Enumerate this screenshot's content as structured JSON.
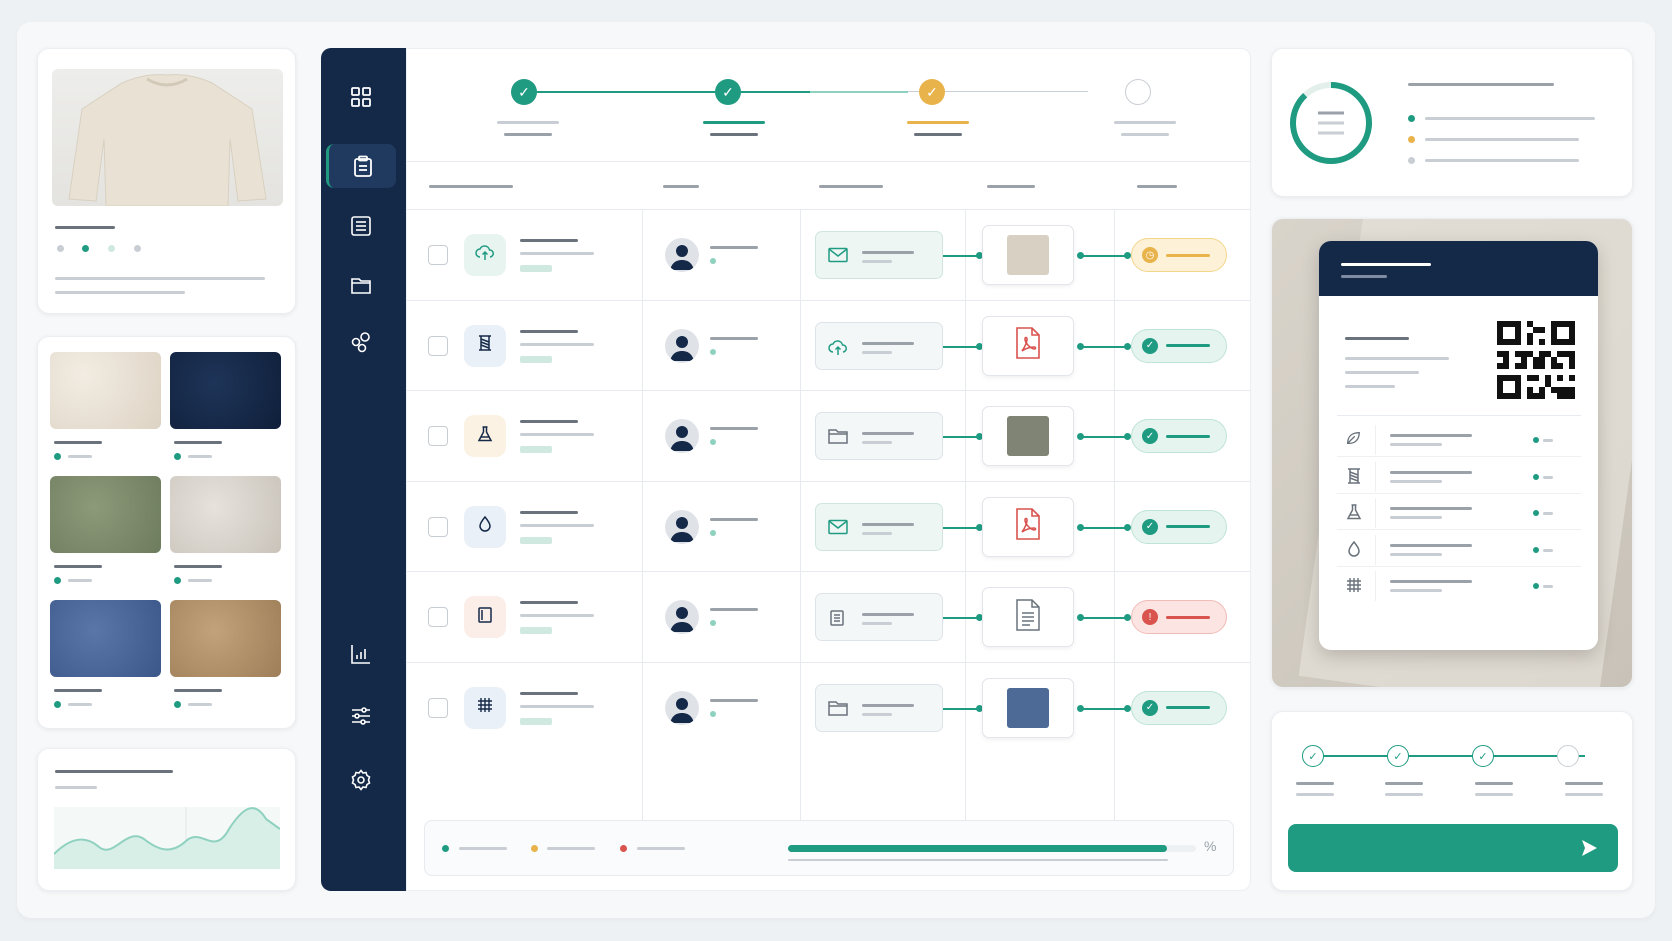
{
  "footer": {
    "percent_symbol": "%",
    "progress": 0.93
  },
  "colors": {
    "teal": "#1f9b82",
    "navy": "#142847",
    "amber": "#e8b34a",
    "red": "#d9534f"
  },
  "sidebar": {
    "items": [
      {
        "icon": "grid-icon",
        "active": false
      },
      {
        "icon": "clipboard-icon",
        "active": true
      },
      {
        "icon": "list-icon",
        "active": false
      },
      {
        "icon": "folder-icon",
        "active": false
      },
      {
        "icon": "network-icon",
        "active": false
      },
      {
        "icon": "chart-icon",
        "active": false
      },
      {
        "icon": "sliders-icon",
        "active": false
      },
      {
        "icon": "gear-icon",
        "active": false
      }
    ]
  },
  "stepper": {
    "steps": [
      {
        "state": "complete",
        "color": "#1f9b82"
      },
      {
        "state": "complete",
        "color": "#1f9b82"
      },
      {
        "state": "current",
        "color": "#e8b34a"
      },
      {
        "state": "pending",
        "color": "#c9ced4"
      }
    ]
  },
  "rows": [
    {
      "icon": "cloud-upload-icon",
      "doc_icon": "mail-icon",
      "attachment": "fabric-swatch",
      "status": "pending"
    },
    {
      "icon": "spool-icon",
      "doc_icon": "cloud-upload-icon",
      "attachment": "pdf-file-icon",
      "status": "approved"
    },
    {
      "icon": "flask-icon",
      "doc_icon": "folder-icon",
      "attachment": "fabric-swatch",
      "status": "approved"
    },
    {
      "icon": "water-drop-icon",
      "doc_icon": "mail-icon",
      "attachment": "pdf-file-icon",
      "status": "approved"
    },
    {
      "icon": "tag-icon",
      "doc_icon": "document-icon",
      "attachment": "text-file-icon",
      "status": "rejected"
    },
    {
      "icon": "weave-icon",
      "doc_icon": "folder-icon",
      "attachment": "fabric-swatch",
      "status": "approved"
    }
  ],
  "passport": {
    "rows": [
      "leaf-icon",
      "spool-icon",
      "flask-icon",
      "water-drop-icon",
      "weave-icon"
    ]
  },
  "bottom_stepper": {
    "steps": [
      "complete",
      "complete",
      "complete",
      "pending"
    ]
  },
  "submit": {
    "icon": "send-arrow-icon"
  }
}
